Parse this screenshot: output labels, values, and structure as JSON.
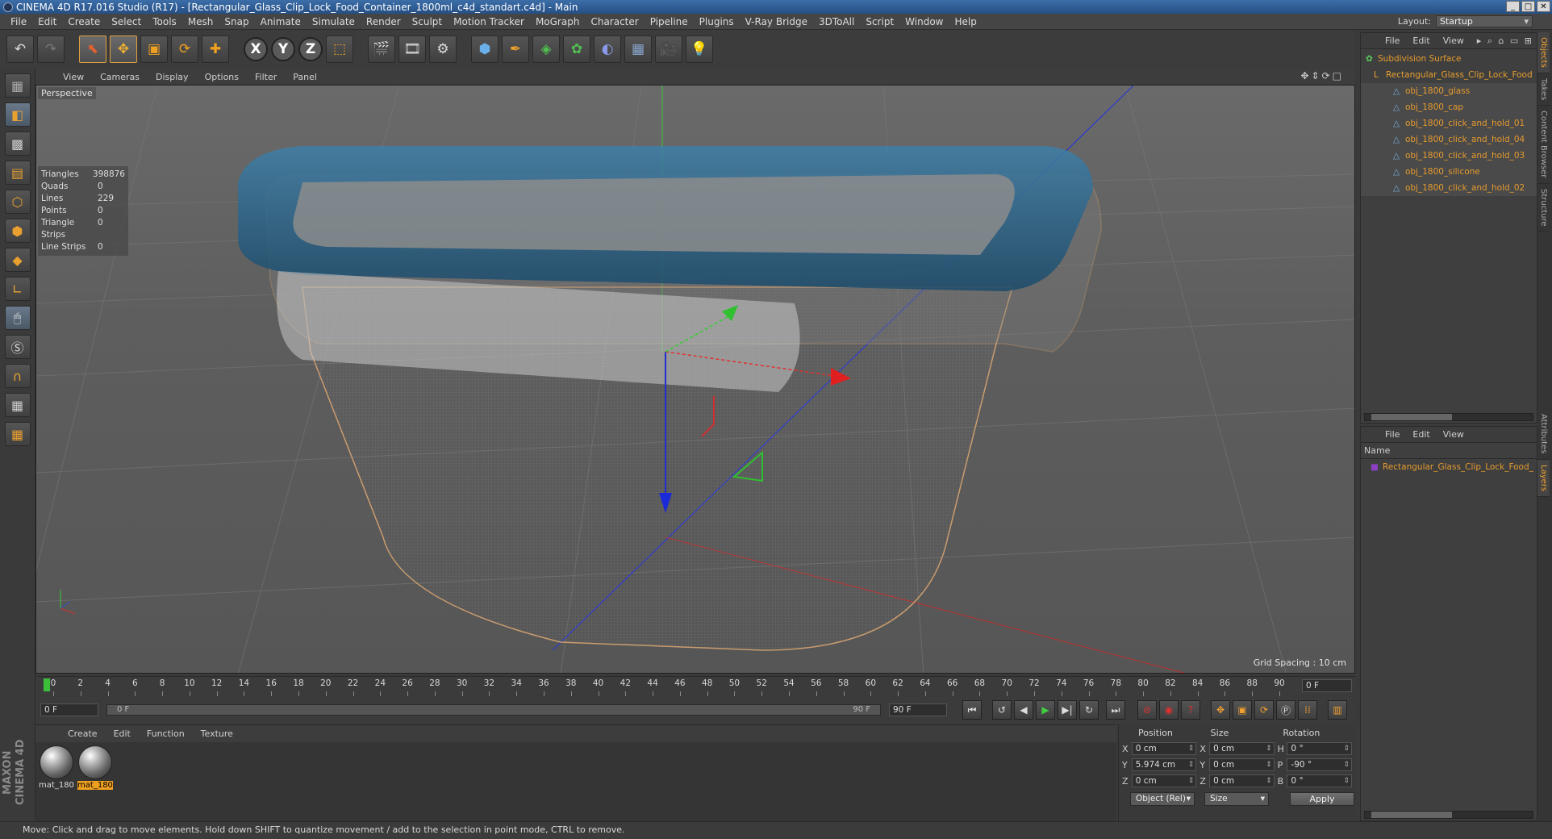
{
  "window": {
    "title": "CINEMA 4D R17.016 Studio (R17) - [Rectangular_Glass_Clip_Lock_Food_Container_1800ml_c4d_standart.c4d] - Main",
    "layout_label": "Layout:",
    "layout_value": "Startup"
  },
  "menu": [
    "File",
    "Edit",
    "Create",
    "Select",
    "Tools",
    "Mesh",
    "Snap",
    "Animate",
    "Simulate",
    "Render",
    "Sculpt",
    "Motion Tracker",
    "MoGraph",
    "Character",
    "Pipeline",
    "Plugins",
    "V-Ray Bridge",
    "3DToAll",
    "Script",
    "Window",
    "Help"
  ],
  "viewport": {
    "menu": [
      "View",
      "Cameras",
      "Display",
      "Options",
      "Filter",
      "Panel"
    ],
    "label": "Perspective",
    "grid_spacing": "Grid Spacing : 10 cm",
    "stats": [
      {
        "k": "Triangles",
        "v": "398876"
      },
      {
        "k": "Quads",
        "v": "0"
      },
      {
        "k": "Lines",
        "v": "229"
      },
      {
        "k": "Points",
        "v": "0"
      },
      {
        "k": "Triangle Strips",
        "v": "0"
      },
      {
        "k": "Line Strips",
        "v": "0"
      }
    ]
  },
  "timeline": {
    "ticks": [
      "0",
      "2",
      "4",
      "6",
      "8",
      "10",
      "12",
      "14",
      "16",
      "18",
      "20",
      "22",
      "24",
      "26",
      "28",
      "30",
      "32",
      "34",
      "36",
      "38",
      "40",
      "42",
      "44",
      "46",
      "48",
      "50",
      "52",
      "54",
      "56",
      "58",
      "60",
      "62",
      "64",
      "66",
      "68",
      "70",
      "72",
      "74",
      "76",
      "78",
      "80",
      "82",
      "84",
      "86",
      "88",
      "90"
    ],
    "current_frame": "0 F",
    "start": "0 F",
    "slider_start": "0 F",
    "slider_end": "90 F",
    "end": "90 F"
  },
  "materials": {
    "menu": [
      "Create",
      "Edit",
      "Function",
      "Texture"
    ],
    "items": [
      "mat_180",
      "mat_180"
    ]
  },
  "coords": {
    "headers": [
      "Position",
      "Size",
      "Rotation"
    ],
    "rows": [
      {
        "axis": "X",
        "pos": "0 cm",
        "saxis": "X",
        "size": "0 cm",
        "raxis": "H",
        "rot": "0 °"
      },
      {
        "axis": "Y",
        "pos": "5.974 cm",
        "saxis": "Y",
        "size": "0 cm",
        "raxis": "P",
        "rot": "-90 °"
      },
      {
        "axis": "Z",
        "pos": "0 cm",
        "saxis": "Z",
        "size": "0 cm",
        "raxis": "B",
        "rot": "0 °"
      }
    ],
    "mode": "Object (Rel)",
    "size_mode": "Size",
    "apply": "Apply"
  },
  "status": "Move: Click and drag to move elements. Hold down SHIFT to quantize movement / add to the selection in point mode, CTRL to remove.",
  "objects": {
    "menu": [
      "File",
      "Edit",
      "View"
    ],
    "items": [
      {
        "label": "Subdivision Surface",
        "indent": 0,
        "type": "grn"
      },
      {
        "label": "Rectangular_Glass_Clip_Lock_Food",
        "indent": 1,
        "type": "null"
      },
      {
        "label": "obj_1800_glass",
        "indent": 2,
        "type": "obj"
      },
      {
        "label": "obj_1800_cap",
        "indent": 2,
        "type": "obj"
      },
      {
        "label": "obj_1800_click_and_hold_01",
        "indent": 2,
        "type": "obj"
      },
      {
        "label": "obj_1800_click_and_hold_04",
        "indent": 2,
        "type": "obj"
      },
      {
        "label": "obj_1800_click_and_hold_03",
        "indent": 2,
        "type": "obj"
      },
      {
        "label": "obj_1800_silicone",
        "indent": 2,
        "type": "obj"
      },
      {
        "label": "obj_1800_click_and_hold_02",
        "indent": 2,
        "type": "obj"
      }
    ]
  },
  "layers": {
    "menu": [
      "File",
      "Edit",
      "View"
    ],
    "name_header": "Name",
    "items": [
      "Rectangular_Glass_Clip_Lock_Food_"
    ]
  },
  "side_tabs": [
    "Objects",
    "Takes",
    "Content Browser",
    "Structure",
    "Attributes",
    "Layers"
  ],
  "brand": "MAXON CINEMA 4D"
}
